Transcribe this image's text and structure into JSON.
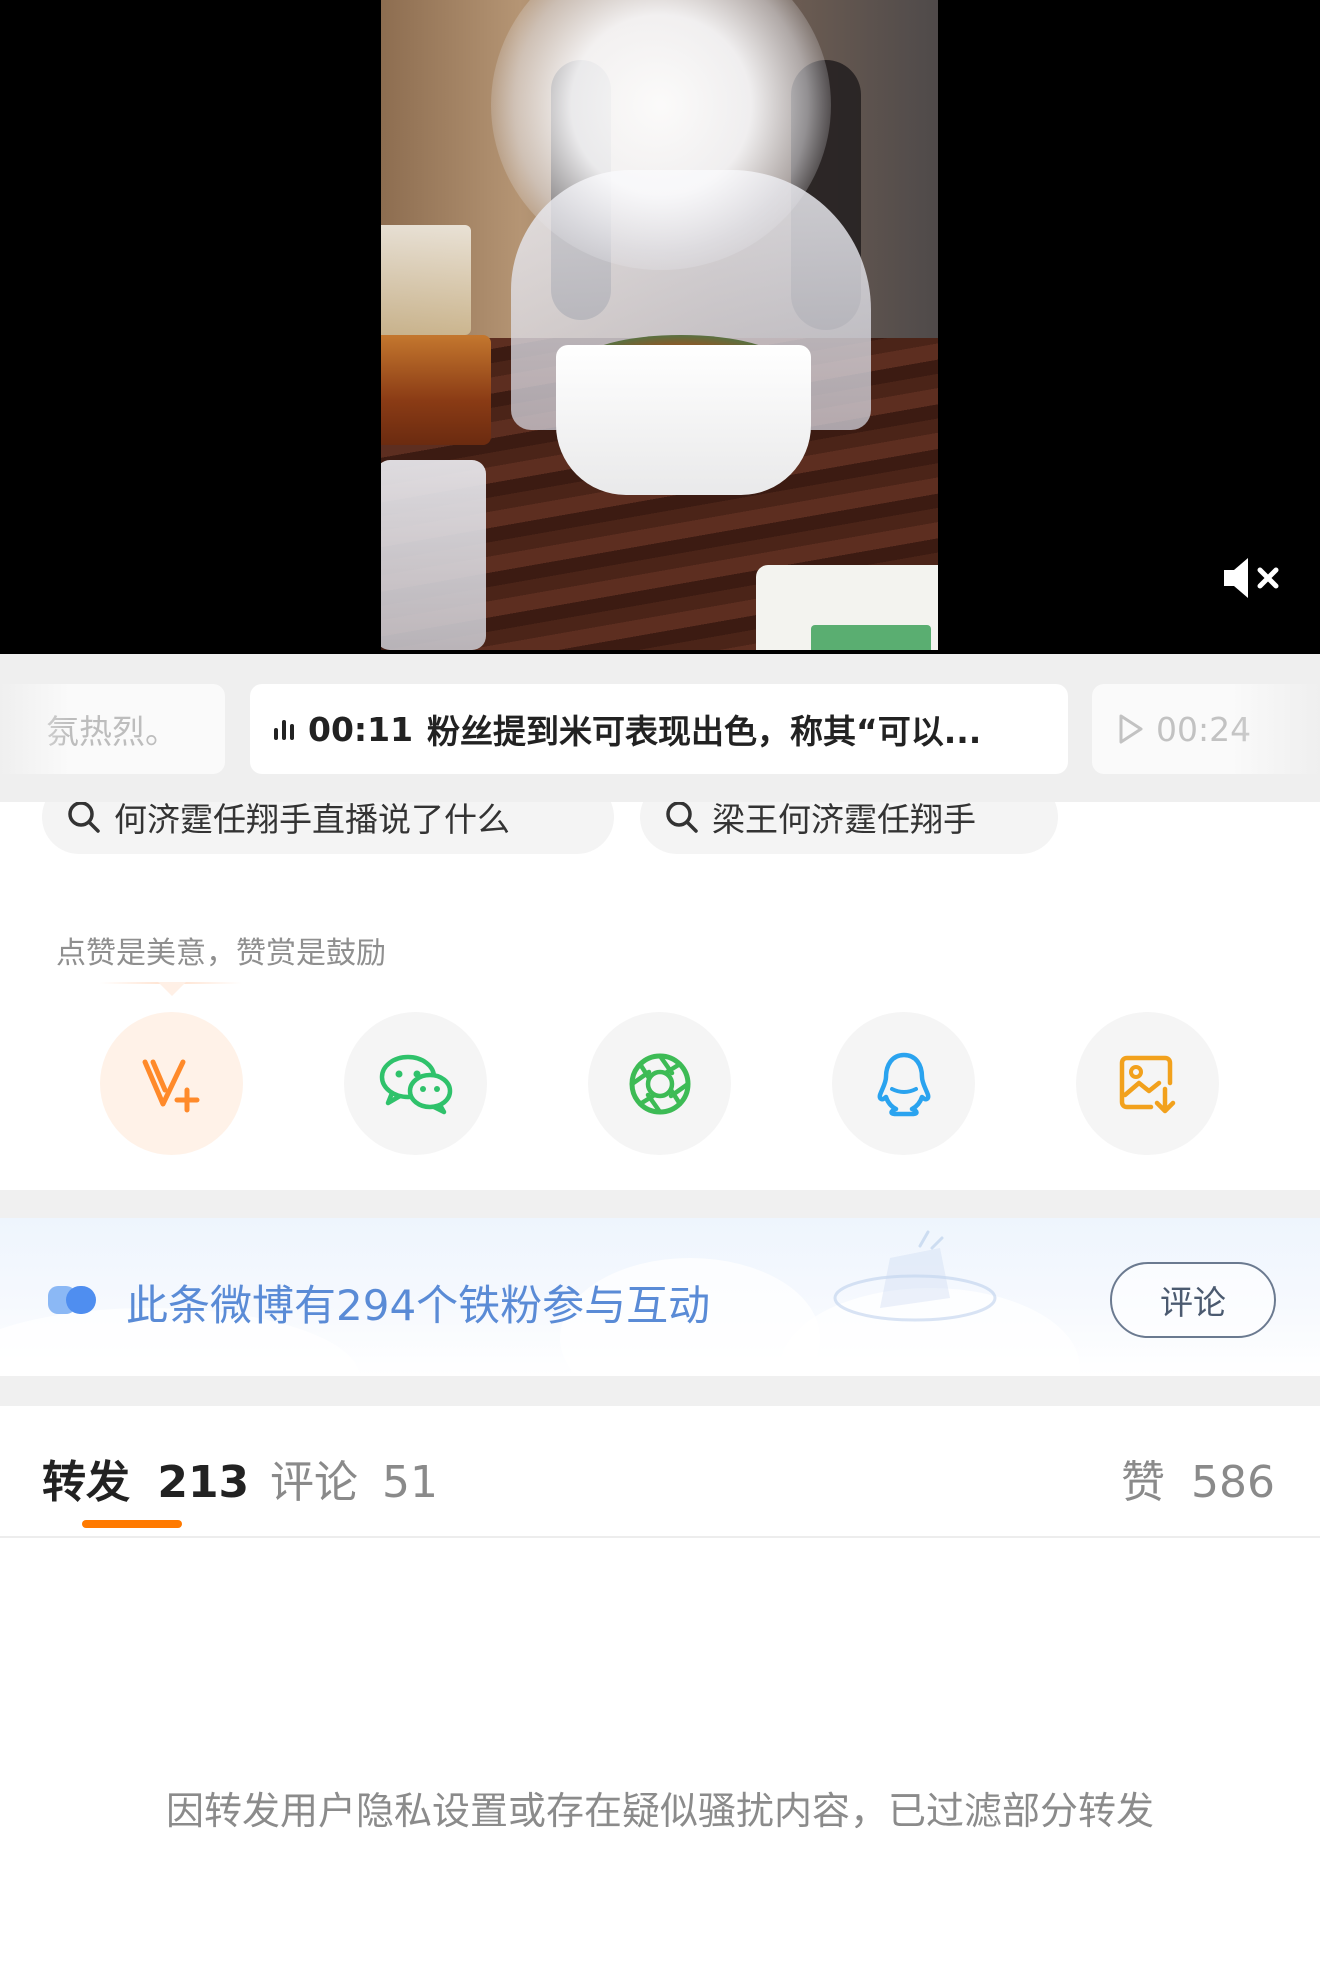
{
  "video": {
    "mute_icon": "speaker-mute-icon"
  },
  "subtitle_chips": {
    "previous_text": "氛热烈。",
    "current_time": "00:11",
    "current_text": "粉丝提到米可表现出色，称其“可以...",
    "next_time": "00:24"
  },
  "search_suggestions": [
    {
      "text": "何济霆任翔手直播说了什么"
    },
    {
      "text": "梁王何济霆任翔手"
    }
  ],
  "reward_tip": "点赞是美意，赞赏是鼓励",
  "share_targets": [
    {
      "name": "v-plus",
      "icon": "v-plus-icon",
      "color": "#ff8a2a"
    },
    {
      "name": "wechat",
      "icon": "wechat-icon",
      "color": "#2fc26b"
    },
    {
      "name": "moments",
      "icon": "moments-icon",
      "color": "#3dbb55"
    },
    {
      "name": "qq",
      "icon": "qq-icon",
      "color": "#2aa3ef"
    },
    {
      "name": "save-image",
      "icon": "save-image-icon",
      "color": "#f2a11c"
    }
  ],
  "iron_fans_banner": {
    "text": "此条微博有294个铁粉参与互动",
    "button_label": "评论",
    "text_color": "#5a8bd6"
  },
  "tabs": {
    "repost": {
      "label": "转发",
      "count": "213"
    },
    "comment": {
      "label": "评论",
      "count": "51"
    },
    "like": {
      "label": "赞",
      "count": "586"
    },
    "accent": "#ff7a00"
  },
  "notice": "因转发用户隐私设置或存在疑似骚扰内容，已过滤部分转发"
}
